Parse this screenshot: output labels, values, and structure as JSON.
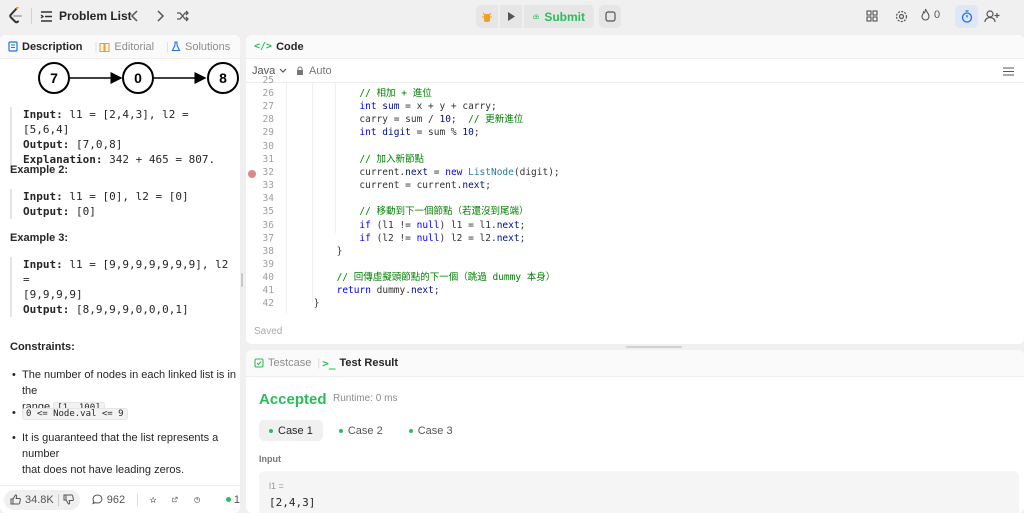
{
  "topbar": {
    "problem_list": "Problem List",
    "submit": "Submit",
    "streak": "0"
  },
  "left_tabs": [
    "Description",
    "Editorial",
    "Solutions"
  ],
  "diagram_nodes": [
    "7",
    "0",
    "8"
  ],
  "example1": {
    "input_label": "Input:",
    "input": "l1 = [2,4,3], l2 = [5,6,4]",
    "output_label": "Output:",
    "output": "[7,0,8]",
    "explanation_label": "Explanation:",
    "explanation": "342 + 465 = 807."
  },
  "example2": {
    "heading": "Example 2:",
    "input_label": "Input:",
    "input": "l1 = [0], l2 = [0]",
    "output_label": "Output:",
    "output": "[0]"
  },
  "example3": {
    "heading": "Example 3:",
    "input_label": "Input:",
    "input_line1": "l1 = [9,9,9,9,9,9,9], l2 =",
    "input_line2": "[9,9,9,9]",
    "output_label": "Output:",
    "output": "[8,9,9,9,0,0,0,1]"
  },
  "constraints": {
    "heading": "Constraints:",
    "c1_line1": "The number of nodes in each linked list is in the",
    "c1_pre": "range",
    "c1_code": "[1, 100]",
    "c1_post": ".",
    "c2_code": "0 <= Node.val <= 9",
    "c3_line1": "It is guaranteed that the list represents a number",
    "c3_line2": "that does not have leading zeros."
  },
  "bottom_bar": {
    "likes": "34.8K",
    "comments": "962",
    "online": "1"
  },
  "code_panel": {
    "title": "Code",
    "language": "Java",
    "auto": "Auto",
    "saved": "Saved",
    "lines": [
      {
        "n": "26",
        "indent": 12,
        "parts": [
          {
            "c": "cm",
            "t": "// 相加 + 進位"
          }
        ]
      },
      {
        "n": "27",
        "indent": 12,
        "parts": [
          {
            "c": "kw",
            "t": "int "
          },
          {
            "c": "fld",
            "t": "sum"
          },
          {
            "c": "",
            "t": " = x + y + carry;"
          }
        ]
      },
      {
        "n": "28",
        "indent": 12,
        "parts": [
          {
            "c": "",
            "t": "carry = sum / "
          },
          {
            "c": "fld",
            "t": "10"
          },
          {
            "c": "",
            "t": ";  "
          },
          {
            "c": "cm",
            "t": "// 更新進位"
          }
        ]
      },
      {
        "n": "29",
        "indent": 12,
        "parts": [
          {
            "c": "kw",
            "t": "int "
          },
          {
            "c": "fld",
            "t": "digit"
          },
          {
            "c": "",
            "t": " = sum % "
          },
          {
            "c": "fld",
            "t": "10"
          },
          {
            "c": "",
            "t": ";"
          }
        ]
      },
      {
        "n": "30",
        "indent": 0,
        "parts": []
      },
      {
        "n": "31",
        "indent": 12,
        "parts": [
          {
            "c": "cm",
            "t": "// 加入新節點"
          }
        ]
      },
      {
        "n": "32",
        "indent": 12,
        "parts": [
          {
            "c": "",
            "t": "current."
          },
          {
            "c": "fld",
            "t": "next"
          },
          {
            "c": "",
            "t": " = "
          },
          {
            "c": "kw",
            "t": "new "
          },
          {
            "c": "ty",
            "t": "ListNode"
          },
          {
            "c": "",
            "t": "(digit);"
          }
        ]
      },
      {
        "n": "33",
        "indent": 12,
        "parts": [
          {
            "c": "",
            "t": "current = current."
          },
          {
            "c": "fld",
            "t": "next"
          },
          {
            "c": "",
            "t": ";"
          }
        ]
      },
      {
        "n": "34",
        "indent": 0,
        "parts": []
      },
      {
        "n": "35",
        "indent": 12,
        "parts": [
          {
            "c": "cm",
            "t": "// 移動到下一個節點（若還沒到尾端）"
          }
        ]
      },
      {
        "n": "36",
        "indent": 12,
        "parts": [
          {
            "c": "kw",
            "t": "if"
          },
          {
            "c": "",
            "t": " (l1 != "
          },
          {
            "c": "kw",
            "t": "null"
          },
          {
            "c": "",
            "t": ") l1 = l1."
          },
          {
            "c": "fld",
            "t": "next"
          },
          {
            "c": "",
            "t": ";"
          }
        ]
      },
      {
        "n": "37",
        "indent": 12,
        "parts": [
          {
            "c": "kw",
            "t": "if"
          },
          {
            "c": "",
            "t": " (l2 != "
          },
          {
            "c": "kw",
            "t": "null"
          },
          {
            "c": "",
            "t": ") l2 = l2."
          },
          {
            "c": "fld",
            "t": "next"
          },
          {
            "c": "",
            "t": ";"
          }
        ]
      },
      {
        "n": "38",
        "indent": 8,
        "parts": [
          {
            "c": "",
            "t": "}"
          }
        ]
      },
      {
        "n": "39",
        "indent": 0,
        "parts": []
      },
      {
        "n": "40",
        "indent": 8,
        "parts": [
          {
            "c": "cm",
            "t": "// 回傳虛擬頭節點的下一個（跳過 dummy 本身）"
          }
        ]
      },
      {
        "n": "41",
        "indent": 8,
        "parts": [
          {
            "c": "kw",
            "t": "return "
          },
          {
            "c": "",
            "t": "dummy."
          },
          {
            "c": "fld",
            "t": "next"
          },
          {
            "c": "",
            "t": ";"
          }
        ]
      },
      {
        "n": "42",
        "indent": 4,
        "parts": [
          {
            "c": "",
            "t": "}"
          }
        ]
      }
    ]
  },
  "result_panel": {
    "tab_testcase": "Testcase",
    "tab_result": "Test Result",
    "status": "Accepted",
    "runtime": "Runtime: 0 ms",
    "cases": [
      "Case 1",
      "Case 2",
      "Case 3"
    ],
    "input_label": "Input",
    "var_label": "l1 =",
    "var_value": "[2,4,3]"
  }
}
